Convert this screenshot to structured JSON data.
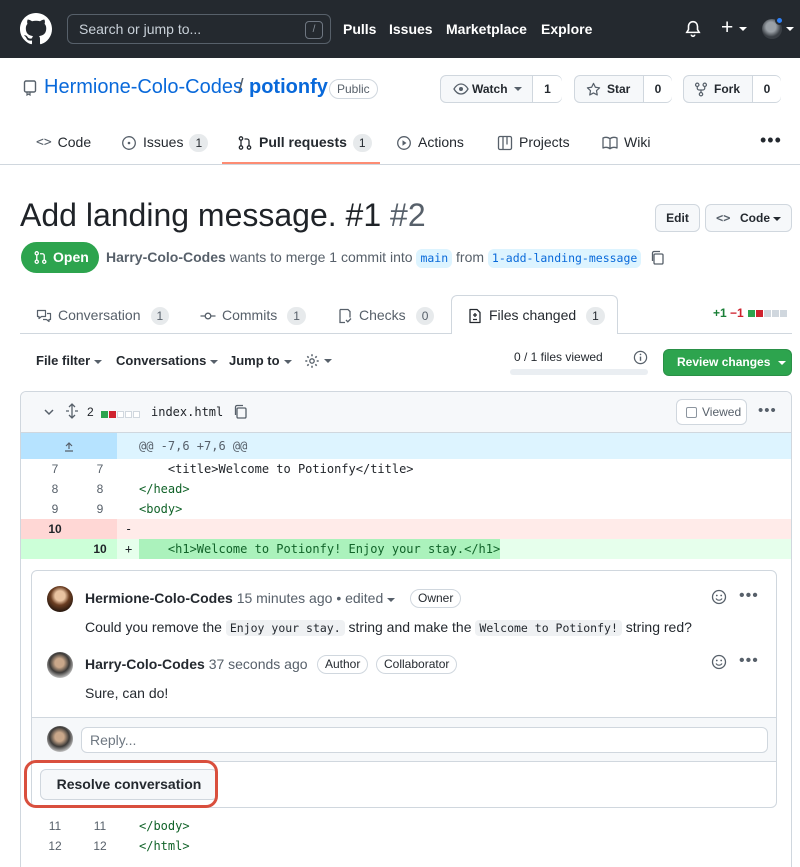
{
  "header": {
    "search_placeholder": "Search or jump to...",
    "search_shortcut": "/",
    "nav": [
      "Pulls",
      "Issues",
      "Marketplace",
      "Explore"
    ]
  },
  "repo": {
    "owner": "Hermione-Colo-Codes",
    "separator": "/",
    "name": "potionfy",
    "visibility": "Public",
    "watch_label": "Watch",
    "watch_count": "1",
    "star_label": "Star",
    "star_count": "0",
    "fork_label": "Fork",
    "fork_count": "0",
    "tabs": [
      {
        "label": "Code",
        "count": ""
      },
      {
        "label": "Issues",
        "count": "1"
      },
      {
        "label": "Pull requests",
        "count": "1"
      },
      {
        "label": "Actions",
        "count": ""
      },
      {
        "label": "Projects",
        "count": ""
      },
      {
        "label": "Wiki",
        "count": ""
      }
    ]
  },
  "pr": {
    "title": "Add landing message. #1",
    "number": "#2",
    "edit_label": "Edit",
    "code_label": "Code",
    "state": "Open",
    "author": "Harry-Colo-Codes",
    "merge_text": "wants to merge 1 commit into",
    "base_branch": "main",
    "from_text": "from",
    "head_branch": "1-add-landing-message",
    "tabs": [
      {
        "label": "Conversation",
        "count": "1"
      },
      {
        "label": "Commits",
        "count": "1"
      },
      {
        "label": "Checks",
        "count": "0"
      },
      {
        "label": "Files changed",
        "count": "1"
      }
    ],
    "additions": "+1",
    "deletions": "−1"
  },
  "toolbar": {
    "file_filter": "File filter",
    "conversations": "Conversations",
    "jump_to": "Jump to",
    "files_viewed": "0 / 1 files viewed",
    "files_viewed_fraction": 0,
    "review_changes": "Review changes"
  },
  "file": {
    "changes": "2",
    "name": "index.html",
    "viewed_label": "Viewed",
    "hunk": "@@ -7,6 +7,6 @@",
    "lines": [
      {
        "old": "7",
        "new": "7",
        "sign": "",
        "code": "    <title>Welcome to Potionfy</title>"
      },
      {
        "old": "8",
        "new": "8",
        "sign": "",
        "code": "</head>"
      },
      {
        "old": "9",
        "new": "9",
        "sign": "",
        "code": "<body>"
      },
      {
        "old": "10",
        "new": "",
        "sign": "-",
        "code": ""
      },
      {
        "old": "",
        "new": "10",
        "sign": "+",
        "code": "    <h1>Welcome to Potionfy! Enjoy your stay.</h1>"
      }
    ],
    "after_lines": [
      {
        "old": "11",
        "new": "11",
        "code": "</body>"
      },
      {
        "old": "12",
        "new": "12",
        "code": "</html>"
      }
    ]
  },
  "thread": {
    "comments": [
      {
        "author": "Hermione-Colo-Codes",
        "time": "15 minutes ago",
        "edited": "• edited",
        "role": "Owner",
        "body_1": "Could you remove the",
        "code_1": "Enjoy your stay.",
        "body_2": "string and make the",
        "code_2": "Welcome to Potionfy!",
        "body_3": "string red?"
      },
      {
        "author": "Harry-Colo-Codes",
        "time": "37 seconds ago",
        "role_1": "Author",
        "role_2": "Collaborator",
        "body": "Sure, can do!"
      }
    ],
    "reply_placeholder": "Reply...",
    "resolve_label": "Resolve conversation"
  },
  "colors": {
    "accent": "#0969da",
    "open_green": "#2da44e",
    "highlight_ring": "#d94f3d",
    "deleted_bg": "#ffebe9",
    "added_bg": "#e6ffec"
  }
}
